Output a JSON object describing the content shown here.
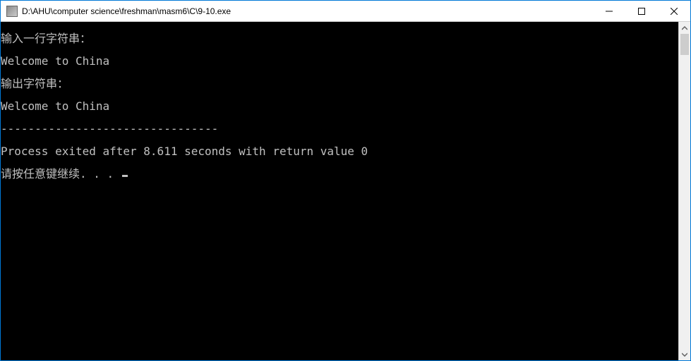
{
  "window": {
    "title": "D:\\AHU\\computer science\\freshman\\masm6\\C\\9-10.exe"
  },
  "console": {
    "lines": [
      "输入一行字符串：",
      "Welcome to China",
      "输出字符串：",
      "Welcome to China",
      "--------------------------------",
      "Process exited after 8.611 seconds with return value 0",
      "请按任意键继续. . . "
    ]
  }
}
